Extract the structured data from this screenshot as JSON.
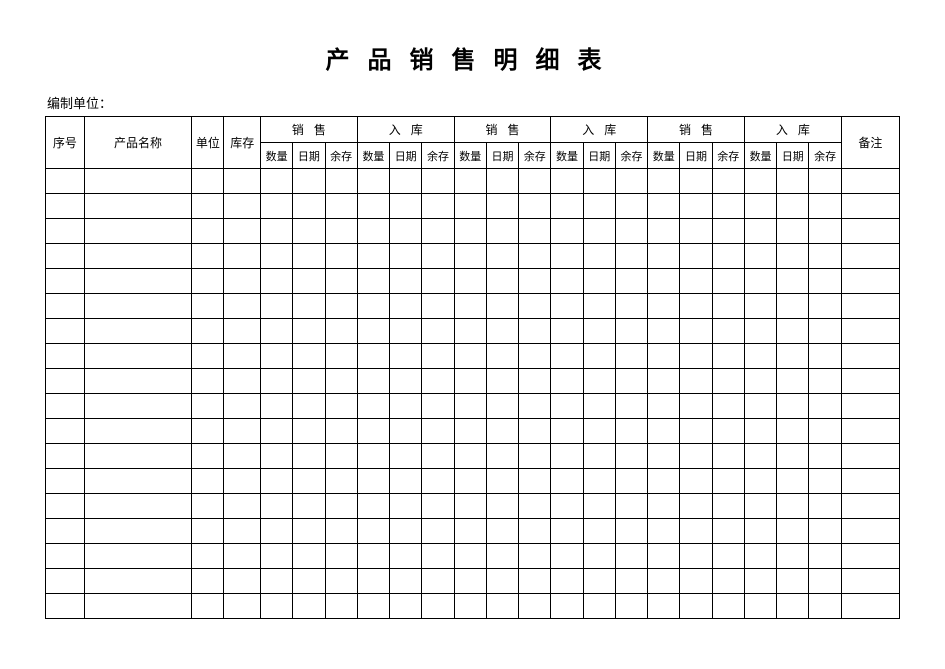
{
  "title": "产品销售明细表",
  "org_label": "编制单位：",
  "headers": {
    "seq": "序号",
    "product_name": "产品名称",
    "unit": "单位",
    "stock": "库存",
    "sale": "销售",
    "inbound": "入库",
    "qty": "数量",
    "date": "日期",
    "remain": "余存",
    "remark": "备注"
  },
  "group_count": 6,
  "group_labels": [
    "销售",
    "入库",
    "销售",
    "入库",
    "销售",
    "入库"
  ],
  "data_row_count": 18
}
